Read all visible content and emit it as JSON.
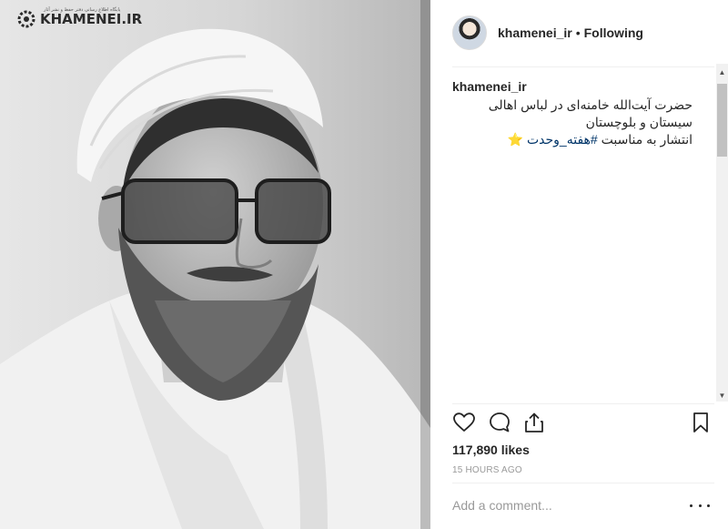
{
  "photo": {
    "watermark_text": "KHAMENEI.IR",
    "watermark_tagline": "پایگاه اطلاع رسانی دفتر حفظ و نشر آثار"
  },
  "header": {
    "username": "khamenei_ir",
    "separator": "•",
    "follow_status": "Following"
  },
  "caption": {
    "username": "khamenei_ir",
    "line1": "حضرت آیت‌الله خامنه‌ای در لباس اهالی سیستان و بلوچستان",
    "line2_prefix": "انتشار به مناسبت ",
    "hashtag": "#هفته_وحدت",
    "emoji": "⭐"
  },
  "actions": {
    "like_icon": "heart-icon",
    "comment_icon": "comment-icon",
    "share_icon": "share-icon",
    "save_icon": "bookmark-icon"
  },
  "likes_text": "117,890 likes",
  "timestamp": "15 HOURS AGO",
  "comment_box": {
    "placeholder": "Add a comment...",
    "more_icon": "more-options-icon"
  },
  "colors": {
    "text": "#262626",
    "muted": "#999999",
    "hashtag": "#003569",
    "divider": "#efefef"
  }
}
